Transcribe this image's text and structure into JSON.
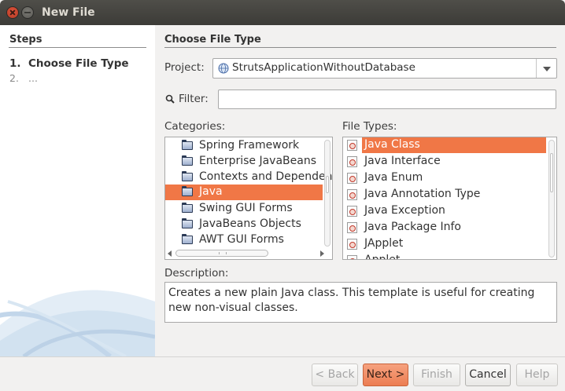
{
  "window": {
    "title": "New File"
  },
  "steps": {
    "heading": "Steps",
    "items": [
      {
        "num": "1.",
        "label": "Choose File Type"
      },
      {
        "num": "2.",
        "label": "..."
      }
    ]
  },
  "main": {
    "heading": "Choose File Type",
    "project_label": "Project:",
    "project_value": "StrutsApplicationWithoutDatabase",
    "filter_label": "Filter:",
    "filter_value": "",
    "categories_label": "Categories:",
    "categories": [
      "Spring Framework",
      "Enterprise JavaBeans",
      "Contexts and Dependency Injection",
      "Java",
      "Swing GUI Forms",
      "JavaBeans Objects",
      "AWT GUI Forms"
    ],
    "selected_category": "Java",
    "file_types_label": "File Types:",
    "file_types": [
      "Java Class",
      "Java Interface",
      "Java Enum",
      "Java Annotation Type",
      "Java Exception",
      "Java Package Info",
      "JApplet",
      "Applet"
    ],
    "selected_file_type": "Java Class",
    "description_label": "Description:",
    "description": "Creates a new plain Java class. This template is useful for creating new non-visual classes."
  },
  "buttons": {
    "back": "< Back",
    "next": "Next >",
    "finish": "Finish",
    "cancel": "Cancel",
    "help": "Help"
  },
  "colors": {
    "selection": "#f07746",
    "titlebar": "#3c3b37"
  }
}
